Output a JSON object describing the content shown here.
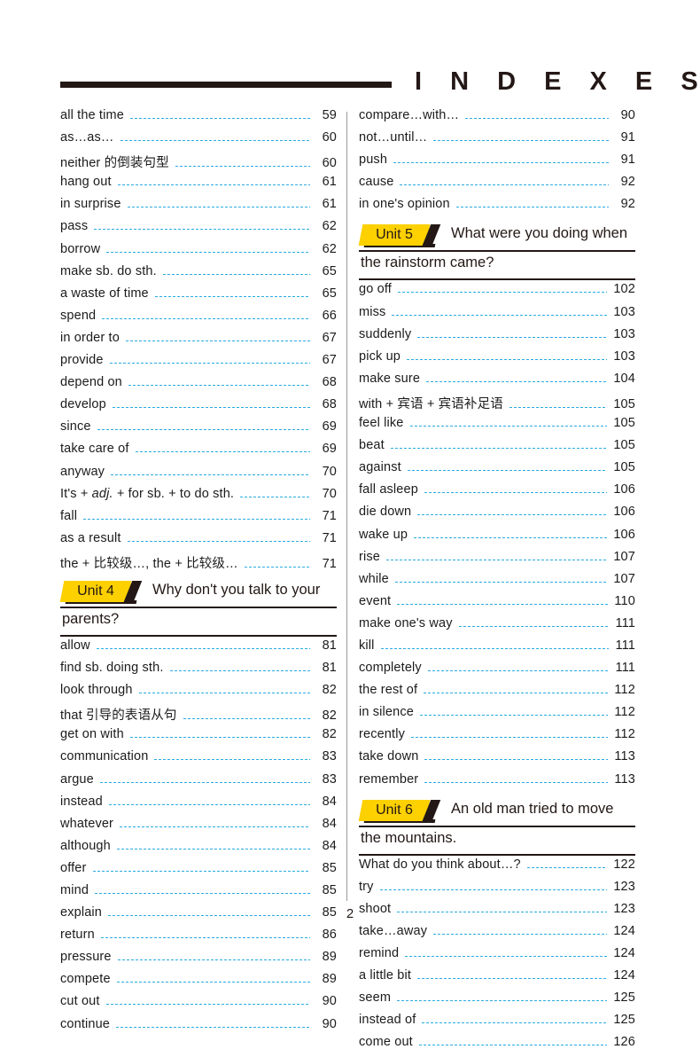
{
  "header": {
    "title": "I N D E X E S  -",
    "rule": "header-rule"
  },
  "page_number": "2",
  "columns": {
    "left": [
      {
        "kind": "entry",
        "term": "all the time",
        "page": "59"
      },
      {
        "kind": "entry",
        "term": "as…as…",
        "page": "60"
      },
      {
        "kind": "entry",
        "term": "neither 的倒装句型",
        "page": "60"
      },
      {
        "kind": "entry",
        "term": "hang out",
        "page": "61"
      },
      {
        "kind": "entry",
        "term": "in surprise",
        "page": "61"
      },
      {
        "kind": "entry",
        "term": "pass",
        "page": "62"
      },
      {
        "kind": "entry",
        "term": "borrow",
        "page": "62"
      },
      {
        "kind": "entry",
        "term": "make sb. do sth.",
        "page": "65"
      },
      {
        "kind": "entry",
        "term": "a waste of time",
        "page": "65"
      },
      {
        "kind": "entry",
        "term": "spend",
        "page": "66"
      },
      {
        "kind": "entry",
        "term": "in order to",
        "page": "67"
      },
      {
        "kind": "entry",
        "term": "provide",
        "page": "67"
      },
      {
        "kind": "entry",
        "term": "depend on",
        "page": "68"
      },
      {
        "kind": "entry",
        "term": "develop",
        "page": "68"
      },
      {
        "kind": "entry",
        "term": "since",
        "page": "69"
      },
      {
        "kind": "entry",
        "term": "take care of",
        "page": "69"
      },
      {
        "kind": "entry",
        "term": "anyway",
        "page": "70"
      },
      {
        "kind": "entry",
        "term": "It's + adj. + for sb. + to do sth.",
        "term_html": "It's + <i>adj.</i> + for sb. + to do sth.",
        "page": "70"
      },
      {
        "kind": "entry",
        "term": "fall",
        "page": "71"
      },
      {
        "kind": "entry",
        "term": "as a result",
        "page": "71"
      },
      {
        "kind": "entry",
        "term": "the + 比较级…, the + 比较级…",
        "page": "71"
      },
      {
        "kind": "unit",
        "badge": "Unit 4",
        "title_line1": "Why don't you talk to your",
        "title_line2": "parents?"
      },
      {
        "kind": "entry",
        "term": "allow",
        "page": "81"
      },
      {
        "kind": "entry",
        "term": "find sb. doing sth.",
        "page": "81"
      },
      {
        "kind": "entry",
        "term": "look through",
        "page": "82"
      },
      {
        "kind": "entry",
        "term": "that 引导的表语从句",
        "page": "82"
      },
      {
        "kind": "entry",
        "term": "get on with",
        "page": "82"
      },
      {
        "kind": "entry",
        "term": "communication",
        "page": "83"
      },
      {
        "kind": "entry",
        "term": "argue",
        "page": "83"
      },
      {
        "kind": "entry",
        "term": "instead",
        "page": "84"
      },
      {
        "kind": "entry",
        "term": "whatever",
        "page": "84"
      },
      {
        "kind": "entry",
        "term": "although",
        "page": "84"
      },
      {
        "kind": "entry",
        "term": "offer",
        "page": "85"
      },
      {
        "kind": "entry",
        "term": "mind",
        "page": "85"
      },
      {
        "kind": "entry",
        "term": "explain",
        "page": "85"
      },
      {
        "kind": "entry",
        "term": "return",
        "page": "86"
      },
      {
        "kind": "entry",
        "term": "pressure",
        "page": "89"
      },
      {
        "kind": "entry",
        "term": "compete",
        "page": "89"
      },
      {
        "kind": "entry",
        "term": "cut out",
        "page": "90"
      },
      {
        "kind": "entry",
        "term": "continue",
        "page": "90"
      }
    ],
    "right": [
      {
        "kind": "entry",
        "term": "compare…with…",
        "page": "90"
      },
      {
        "kind": "entry",
        "term": "not…until…",
        "page": "91"
      },
      {
        "kind": "entry",
        "term": "push",
        "page": "91"
      },
      {
        "kind": "entry",
        "term": "cause",
        "page": "92"
      },
      {
        "kind": "entry",
        "term": "in one's opinion",
        "page": "92"
      },
      {
        "kind": "unit",
        "badge": "Unit 5",
        "title_line1": "What were you doing when",
        "title_line2": "the rainstorm came?"
      },
      {
        "kind": "entry",
        "term": "go off",
        "page": "102"
      },
      {
        "kind": "entry",
        "term": "miss",
        "page": "103"
      },
      {
        "kind": "entry",
        "term": "suddenly",
        "page": "103"
      },
      {
        "kind": "entry",
        "term": "pick up",
        "page": "103"
      },
      {
        "kind": "entry",
        "term": "make sure",
        "page": "104"
      },
      {
        "kind": "entry",
        "term": "with + 宾语 + 宾语补足语",
        "page": "105"
      },
      {
        "kind": "entry",
        "term": "feel like",
        "page": "105"
      },
      {
        "kind": "entry",
        "term": "beat",
        "page": "105"
      },
      {
        "kind": "entry",
        "term": "against",
        "page": "105"
      },
      {
        "kind": "entry",
        "term": "fall asleep",
        "page": "106"
      },
      {
        "kind": "entry",
        "term": "die down",
        "page": "106"
      },
      {
        "kind": "entry",
        "term": "wake up",
        "page": "106"
      },
      {
        "kind": "entry",
        "term": "rise",
        "page": "107"
      },
      {
        "kind": "entry",
        "term": "while",
        "page": "107"
      },
      {
        "kind": "entry",
        "term": "event",
        "page": "110"
      },
      {
        "kind": "entry",
        "term": "make one's way",
        "page": "111"
      },
      {
        "kind": "entry",
        "term": "kill",
        "page": "111"
      },
      {
        "kind": "entry",
        "term": "completely",
        "page": "111"
      },
      {
        "kind": "entry",
        "term": "the rest of",
        "page": "112"
      },
      {
        "kind": "entry",
        "term": "in silence",
        "page": "112"
      },
      {
        "kind": "entry",
        "term": "recently",
        "page": "112"
      },
      {
        "kind": "entry",
        "term": "take down",
        "page": "113"
      },
      {
        "kind": "entry",
        "term": "remember",
        "page": "113"
      },
      {
        "kind": "unit",
        "badge": "Unit 6",
        "title_line1": "An old man tried to move",
        "title_line2": "the mountains."
      },
      {
        "kind": "entry",
        "term": "What do you think about…?",
        "page": "122"
      },
      {
        "kind": "entry",
        "term": "try",
        "page": "123"
      },
      {
        "kind": "entry",
        "term": "shoot",
        "page": "123"
      },
      {
        "kind": "entry",
        "term": "take…away",
        "page": "124"
      },
      {
        "kind": "entry",
        "term": "remind",
        "page": "124"
      },
      {
        "kind": "entry",
        "term": "a little bit",
        "page": "124"
      },
      {
        "kind": "entry",
        "term": "seem",
        "page": "125"
      },
      {
        "kind": "entry",
        "term": "instead of",
        "page": "125"
      },
      {
        "kind": "entry",
        "term": "come out",
        "page": "126"
      }
    ]
  },
  "colors": {
    "leader_dots": "#29abe2",
    "badge_yellow": "#fdd000",
    "ink": "#231815",
    "divider": "#9a9a9a"
  }
}
